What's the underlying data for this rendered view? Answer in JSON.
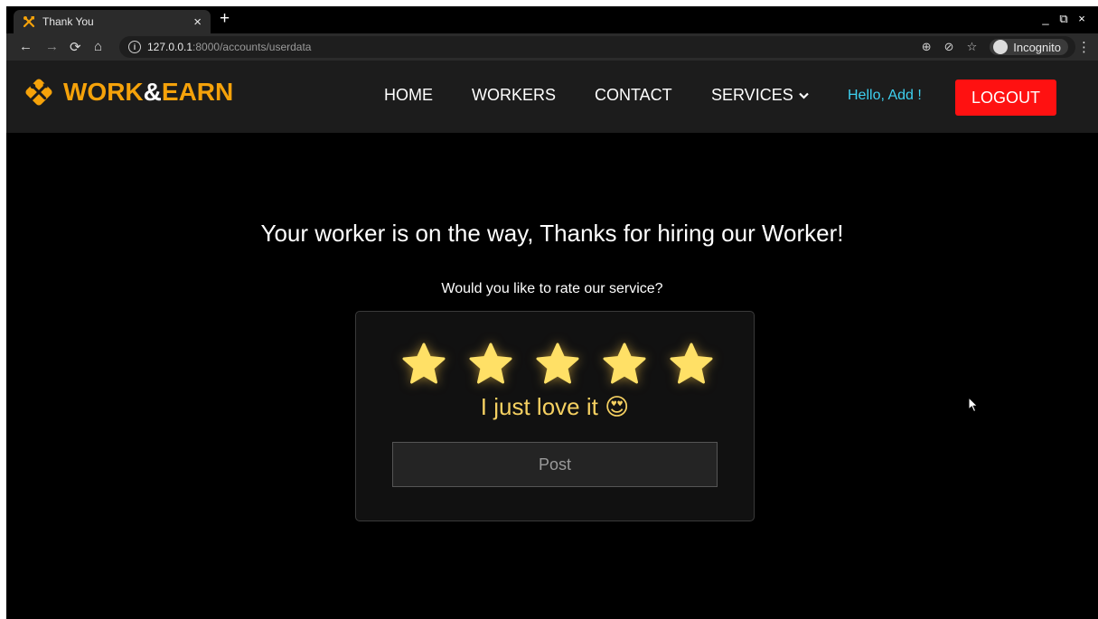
{
  "browser": {
    "tab_title": "Thank You",
    "tab_close": "×",
    "new_tab": "+",
    "url_host": "127.0.0.1",
    "url_rest": ":8000/accounts/userdata",
    "incognito_label": "Incognito",
    "window_controls": [
      "_",
      "⧉",
      "×"
    ]
  },
  "site": {
    "brand_part1": "WORK",
    "brand_part2": "&",
    "brand_part3": "EARN",
    "nav": {
      "home": "HOME",
      "workers": "WORKERS",
      "contact": "CONTACT",
      "services": "SERVICES"
    },
    "greeting": "Hello, Add !",
    "logout_label": "LOGOUT"
  },
  "content": {
    "headline": "Your worker is on the way, Thanks for hiring our Worker!",
    "prompt": "Would you like to rate our service?",
    "rating": {
      "selected": 5,
      "max": 5
    },
    "rating_text": "I just love it 😍",
    "post_label": "Post"
  },
  "colors": {
    "brand_orange": "#f5a20a",
    "greeting_cyan": "#3ed1f0",
    "logout_red": "#ff1111",
    "star_yellow": "#ffe066"
  }
}
